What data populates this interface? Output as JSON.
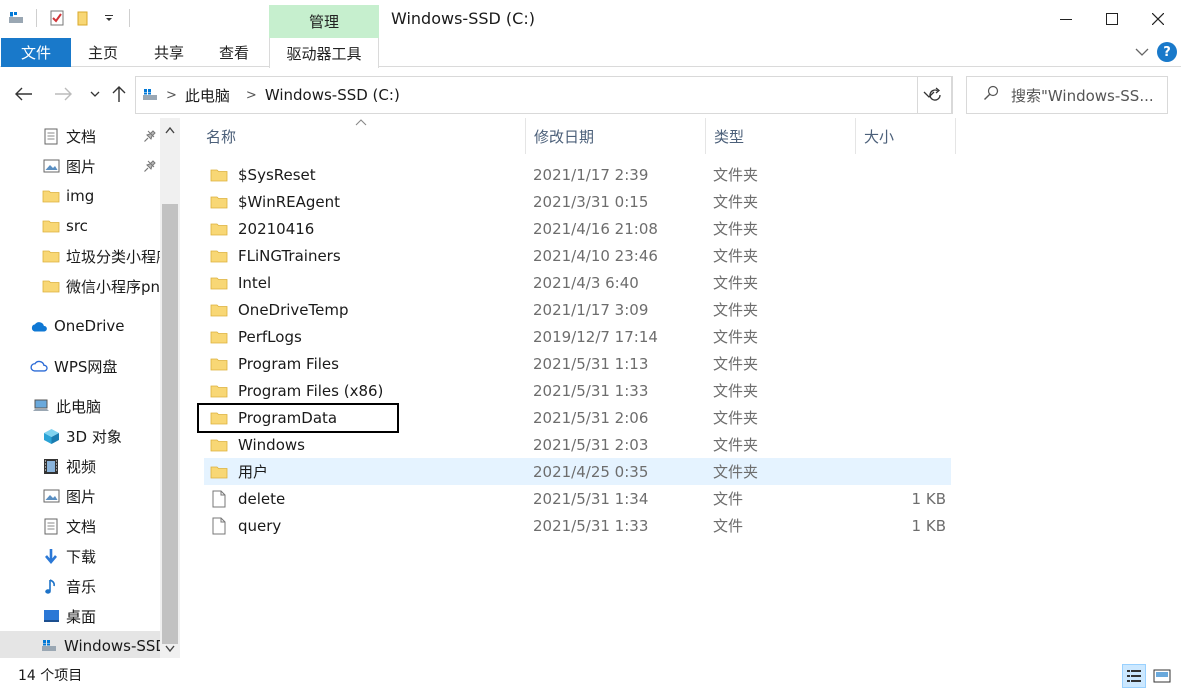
{
  "window": {
    "title": "Windows-SSD (C:)",
    "context_tab": "管理"
  },
  "ribbon": {
    "tabs": [
      "文件",
      "主页",
      "共享",
      "查看",
      "驱动器工具"
    ]
  },
  "address": {
    "crumbs": [
      "此电脑",
      "Windows-SSD (C:)"
    ]
  },
  "search": {
    "placeholder": "搜索\"Windows-SS..."
  },
  "nav": {
    "items": [
      {
        "label": "文档",
        "icon": "document-icon",
        "pinned": true
      },
      {
        "label": "图片",
        "icon": "pictures-icon",
        "pinned": true
      },
      {
        "label": "img",
        "icon": "folder-icon",
        "pinned": false
      },
      {
        "label": "src",
        "icon": "folder-icon",
        "pinned": false
      },
      {
        "label": "垃圾分类小程序",
        "icon": "folder-icon",
        "pinned": false
      },
      {
        "label": "微信小程序pn",
        "icon": "folder-icon",
        "pinned": false
      },
      {
        "label": "OneDrive",
        "icon": "onedrive-icon",
        "pinned": false
      },
      {
        "label": "WPS网盘",
        "icon": "cloud-icon",
        "pinned": false
      },
      {
        "label": "此电脑",
        "icon": "computer-icon",
        "pinned": false
      },
      {
        "label": "3D 对象",
        "icon": "3d-objects-icon",
        "pinned": false
      },
      {
        "label": "视频",
        "icon": "video-icon",
        "pinned": false
      },
      {
        "label": "图片",
        "icon": "pictures-icon",
        "pinned": false
      },
      {
        "label": "文档",
        "icon": "document-icon",
        "pinned": false
      },
      {
        "label": "下载",
        "icon": "download-icon",
        "pinned": false
      },
      {
        "label": "音乐",
        "icon": "music-icon",
        "pinned": false
      },
      {
        "label": "桌面",
        "icon": "desktop-icon",
        "pinned": false
      },
      {
        "label": "Windows-SSD",
        "icon": "drive-icon",
        "pinned": false
      }
    ]
  },
  "columns": {
    "name": "名称",
    "date": "修改日期",
    "type": "类型",
    "size": "大小"
  },
  "files": [
    {
      "name": "$SysReset",
      "date": "2021/1/17 2:39",
      "type": "文件夹",
      "size": "",
      "icon": "folder-icon"
    },
    {
      "name": "$WinREAgent",
      "date": "2021/3/31 0:15",
      "type": "文件夹",
      "size": "",
      "icon": "folder-icon"
    },
    {
      "name": "20210416",
      "date": "2021/4/16 21:08",
      "type": "文件夹",
      "size": "",
      "icon": "folder-icon"
    },
    {
      "name": "FLiNGTrainers",
      "date": "2021/4/10 23:46",
      "type": "文件夹",
      "size": "",
      "icon": "folder-icon"
    },
    {
      "name": "Intel",
      "date": "2021/4/3 6:40",
      "type": "文件夹",
      "size": "",
      "icon": "folder-icon"
    },
    {
      "name": "OneDriveTemp",
      "date": "2021/1/17 3:09",
      "type": "文件夹",
      "size": "",
      "icon": "folder-icon"
    },
    {
      "name": "PerfLogs",
      "date": "2019/12/7 17:14",
      "type": "文件夹",
      "size": "",
      "icon": "folder-icon"
    },
    {
      "name": "Program Files",
      "date": "2021/5/31 1:13",
      "type": "文件夹",
      "size": "",
      "icon": "folder-icon"
    },
    {
      "name": "Program Files (x86)",
      "date": "2021/5/31 1:33",
      "type": "文件夹",
      "size": "",
      "icon": "folder-icon"
    },
    {
      "name": "ProgramData",
      "date": "2021/5/31 2:06",
      "type": "文件夹",
      "size": "",
      "icon": "folder-icon"
    },
    {
      "name": "Windows",
      "date": "2021/5/31 2:03",
      "type": "文件夹",
      "size": "",
      "icon": "folder-icon"
    },
    {
      "name": "用户",
      "date": "2021/4/25 0:35",
      "type": "文件夹",
      "size": "",
      "icon": "folder-icon"
    },
    {
      "name": "delete",
      "date": "2021/5/31 1:34",
      "type": "文件",
      "size": "1 KB",
      "icon": "file-icon"
    },
    {
      "name": "query",
      "date": "2021/5/31 1:33",
      "type": "文件",
      "size": "1 KB",
      "icon": "file-icon"
    }
  ],
  "selected_file": "用户",
  "highlighted_file": "ProgramData",
  "status": {
    "count": "14 个项目"
  },
  "colors": {
    "accent": "#1979ca",
    "folder": "#f8d775",
    "selection": "#e5f3ff",
    "context_tab": "#c6efce"
  }
}
